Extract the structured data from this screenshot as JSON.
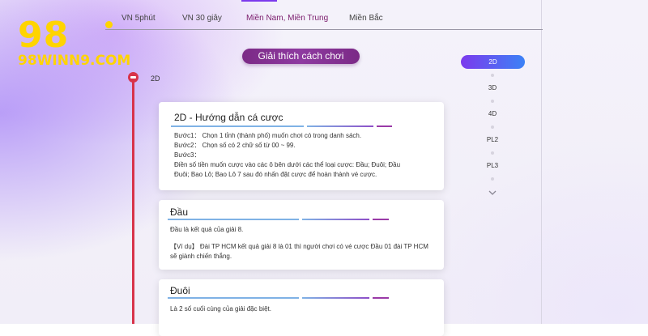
{
  "brand": {
    "logo_number": "98",
    "logo_text": "98WINN9.COM",
    "color": "#ffd400"
  },
  "tabs": [
    {
      "label": "VN 5phút",
      "active": false
    },
    {
      "label": "VN 30 giây",
      "active": false
    },
    {
      "label": "Miền Nam, Miền Trung",
      "active": true
    },
    {
      "label": "Miền Bắc",
      "active": false
    }
  ],
  "explain_button": {
    "label": "Giải thích cách chơi"
  },
  "timeline": {
    "current_label": "2D",
    "accent": "#d8334a"
  },
  "side_nav": {
    "items": [
      {
        "label": "2D",
        "active": true
      },
      {
        "label": "3D",
        "active": false
      },
      {
        "label": "4D",
        "active": false
      },
      {
        "label": "PL2",
        "active": false
      },
      {
        "label": "PL3",
        "active": false
      }
    ]
  },
  "cards": {
    "guide": {
      "title": "2D - Hướng dẫn cá cược",
      "lines": [
        "Bước1：  Chọn 1 tỉnh (thành phố) muốn chơi có trong danh sách.",
        "Bước2：  Chọn số có 2 chữ số từ 00 ~ 99.",
        "Bước3：",
        "Điền số tiền muốn cược vào các ô bên dưới các thể loại cược: Đầu; Đuôi; Đầu",
        "Đuôi; Bao Lô; Bao Lô 7 sau đó nhấn đặt cược để hoàn thành vé cược."
      ]
    },
    "dau": {
      "title": "Đầu",
      "line1": "Đầu là kết quả của giải 8.",
      "example_1": "【Ví dụ】  Đài TP HCM kết quả giải 8 là 01 thì người chơi có vé cược Đầu 01 đài TP HCM",
      "example_2": "sẽ giành chiến thắng."
    },
    "duoi": {
      "title": "Đuôi",
      "line1": "Là 2 số cuối cùng của giải đặc biệt."
    }
  }
}
